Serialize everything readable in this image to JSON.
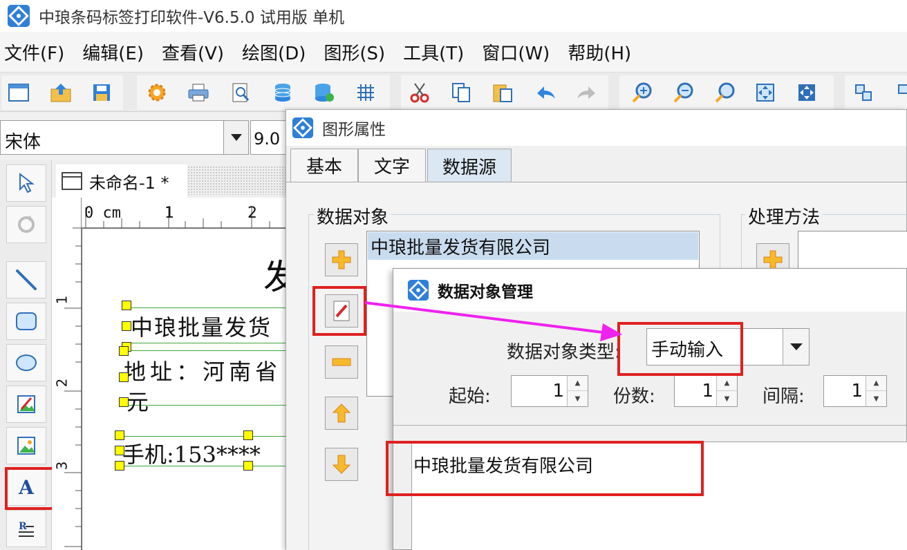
{
  "window": {
    "title": "中琅条码标签打印软件-V6.5.0 试用版 单机"
  },
  "menu": [
    "文件(F)",
    "编辑(E)",
    "查看(V)",
    "绘图(D)",
    "图形(S)",
    "工具(T)",
    "窗口(W)",
    "帮助(H)"
  ],
  "toolbar": {
    "icons": [
      "new-icon",
      "open-icon",
      "save-icon",
      "settings-icon",
      "print-icon",
      "print-preview-icon",
      "database-icon",
      "database-connect-icon",
      "grid-icon",
      "cut-icon",
      "copy-icon",
      "paste-icon",
      "undo-icon",
      "redo-icon",
      "zoom-in-icon",
      "zoom-out-icon",
      "zoom-icon",
      "fit-page-icon",
      "fit-width-icon",
      "align-icon",
      "group-icon"
    ]
  },
  "font": {
    "family": "宋体",
    "size": "9.0"
  },
  "document": {
    "tab_label": "未命名-1 *"
  },
  "canvas": {
    "heading_partial": "发",
    "line1": "中琅批量发货",
    "line2a": "地址：河南省",
    "line2b": "元",
    "line3": "手机:153****"
  },
  "ruler": {
    "h_labels": [
      "0 cm",
      "1",
      "2"
    ],
    "v_labels": [
      "1",
      "2",
      "3"
    ]
  },
  "property_dialog": {
    "title": "图形属性",
    "tabs": [
      "基本",
      "文字",
      "数据源"
    ],
    "active_tab": "数据源",
    "data_object_group": "数据对象",
    "process_group": "处理方法",
    "data_object_item": "中琅批量发货有限公司"
  },
  "data_object_dialog": {
    "title": "数据对象管理",
    "type_label": "数据对象类型:",
    "type_value": "手动输入",
    "start_label": "起始:",
    "start_value": "1",
    "copies_label": "份数:",
    "copies_value": "1",
    "interval_label": "间隔:",
    "interval_value": "1",
    "content": "中琅批量发货有限公司"
  },
  "colors": {
    "highlight": "#e02020",
    "arrow": "#ee22ee",
    "list_selected": "#c9dcef",
    "handle": "#ffff00"
  }
}
